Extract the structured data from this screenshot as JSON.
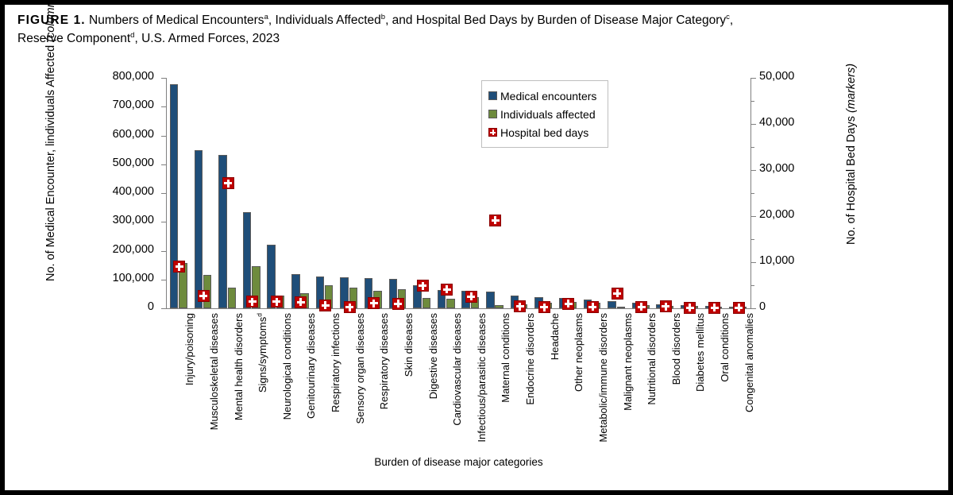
{
  "title": {
    "figure_label": "FIGURE 1.",
    "text_part1": "Numbers of Medical Encounters",
    "sup_a": "a",
    "text_part2": ", Individuals Affected",
    "sup_b": "b",
    "text_part3": ", and Hospital Bed Days by Burden of Disease Major Category",
    "sup_c": "c",
    "text_part4": ",",
    "line2_part1": "Reserve Component",
    "sup_d": "d",
    "line2_part2": ", U.S. Armed Forces, 2023"
  },
  "legend": {
    "items": [
      {
        "label": "Medical encounters",
        "icon": "blue-square-swatch",
        "color": "#1F4E79"
      },
      {
        "label": "Individuals affected",
        "icon": "green-square-swatch",
        "color": "#6E8B3D"
      },
      {
        "label": "Hospital bed days",
        "icon": "red-cross-marker",
        "color": "#C00000"
      }
    ]
  },
  "axes": {
    "y_left_title_main": "No. of Medical Encounter, lindividuals Affected ",
    "y_left_title_ital": "(columns)",
    "y_right_title_main": "No. of Hospital Bed Days ",
    "y_right_title_ital": "(markers)",
    "x_title": "Burden of disease major categories",
    "y_left_ticks": [
      "800,000",
      "700,000",
      "600,000",
      "500,000",
      "400,000",
      "300,000",
      "200,000",
      "100,000",
      "0"
    ],
    "y_right_ticks": [
      "50,000",
      "40,000",
      "30,000",
      "20,000",
      "10,000",
      "0"
    ]
  },
  "chart_data": {
    "type": "bar",
    "title": "Numbers of Medical Encounters, Individuals Affected, and Hospital Bed Days by Burden of Disease Major Category, Reserve Component, U.S. Armed Forces, 2023",
    "xlabel": "Burden of disease major categories",
    "ylabel": "No. of Medical Encounter, lindividuals Affected (columns)",
    "y2label": "No. of Hospital Bed Days (markers)",
    "ylim": [
      0,
      800000
    ],
    "y2lim": [
      0,
      50000
    ],
    "ytick_step": 100000,
    "y2tick_step": 10000,
    "grid": false,
    "legend_position": "top-right",
    "categories": [
      "Injury/poisoning",
      "Musculoskeletal diseases",
      "Mental health disorders",
      "Signs/symptomsᵈ",
      "Neurological conditions",
      "Genitourinary diseases",
      "Respiratory infections",
      "Sensory organ diseases",
      "Respiratory diseases",
      "Skin diseases",
      "Digestive diseases",
      "Cardiovascular diseases",
      "Infectious/parasitic diseases",
      "Maternal conditions",
      "Endocrine disorders",
      "Headache",
      "Other neoplasms",
      "Metabolic/immune disorders",
      "Malignant neoplasms",
      "Nutritional disorders",
      "Blood disorders",
      "Diabetes mellitus",
      "Oral conditions",
      "Congenital anomalies"
    ],
    "series": [
      {
        "name": "Medical encounters",
        "axis": "left",
        "color": "#1F4E79",
        "values": [
          778000,
          550000,
          533000,
          335000,
          222000,
          120000,
          110000,
          109000,
          105000,
          101000,
          79000,
          64000,
          61000,
          59000,
          44000,
          38000,
          35000,
          30000,
          25000,
          19000,
          15000,
          12000,
          8000,
          5000
        ]
      },
      {
        "name": "Individuals affected",
        "axis": "left",
        "color": "#6E8B3D",
        "values": [
          158000,
          115000,
          71000,
          146000,
          45000,
          52000,
          79000,
          72000,
          62000,
          67000,
          37000,
          33000,
          38000,
          11000,
          15000,
          19000,
          23000,
          19000,
          5000,
          10000,
          8000,
          7000,
          4000,
          3000
        ]
      },
      {
        "name": "Hospital bed days",
        "axis": "right",
        "color": "#C00000",
        "marker": "red-cross",
        "values": [
          9100,
          2800,
          27200,
          1500,
          1500,
          1400,
          700,
          300,
          1200,
          1100,
          5000,
          4200,
          2600,
          19200,
          500,
          300,
          1100,
          400,
          3300,
          400,
          500,
          250,
          250,
          200
        ]
      }
    ]
  }
}
